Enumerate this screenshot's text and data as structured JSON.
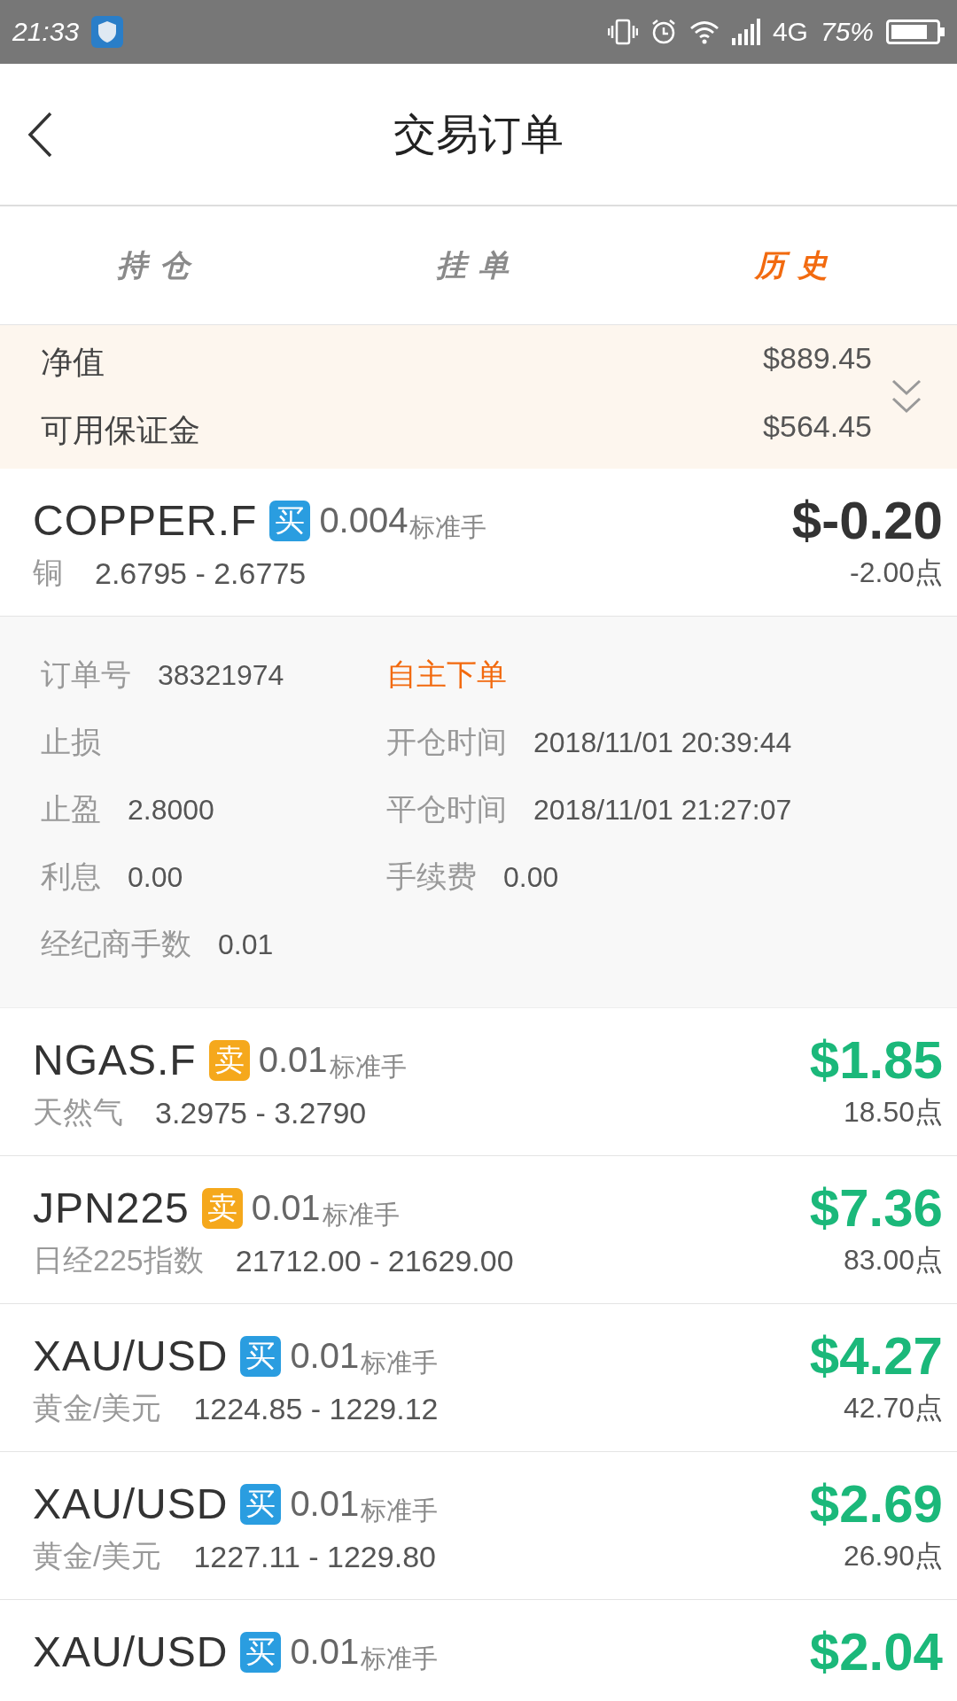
{
  "status_bar": {
    "time": "21:33",
    "network": "4G",
    "battery": "75%"
  },
  "header": {
    "title": "交易订单"
  },
  "tabs": [
    {
      "label": "持仓",
      "selected": false
    },
    {
      "label": "挂单",
      "selected": false
    },
    {
      "label": "历史",
      "selected": true
    }
  ],
  "summary": {
    "rows": [
      {
        "label": "净值",
        "value": "$889.45"
      },
      {
        "label": "可用保证金",
        "value": "$564.45"
      }
    ]
  },
  "orders": [
    {
      "symbol": "COPPER.F",
      "kind": "buy",
      "side_label": "买",
      "lots": "0.004",
      "lot_unit": "标准手",
      "profit": "$-0.20",
      "color": "#333333",
      "name": "铜",
      "prices": "2.6795 - 2.6775",
      "points": "-2.00点",
      "details": [
        {
          "kind": "field",
          "label": "订单号",
          "value": "38321974"
        },
        {
          "kind": "tag",
          "text": "自主下单"
        },
        {
          "kind": "field",
          "label": "止损"
        },
        {
          "kind": "field",
          "label": "开仓时间",
          "value": "2018/11/01 20:39:44"
        },
        {
          "kind": "field",
          "label": "止盈",
          "value": "2.8000"
        },
        {
          "kind": "field",
          "label": "平仓时间",
          "value": "2018/11/01 21:27:07"
        },
        {
          "kind": "field",
          "label": "利息",
          "value": "0.00"
        },
        {
          "kind": "field",
          "label": "手续费",
          "value": "0.00"
        },
        {
          "kind": "field",
          "label": "经纪商手数",
          "value": "0.01"
        }
      ]
    },
    {
      "symbol": "NGAS.F",
      "kind": "sell",
      "side_label": "卖",
      "lots": "0.01",
      "lot_unit": "标准手",
      "profit": "$1.85",
      "color": "#1bb87a",
      "name": "天然气",
      "prices": "3.2975 - 3.2790",
      "points": "18.50点"
    },
    {
      "symbol": "JPN225",
      "kind": "sell",
      "side_label": "卖",
      "lots": "0.01",
      "lot_unit": "标准手",
      "profit": "$7.36",
      "color": "#1bb87a",
      "name": "日经225指数",
      "prices": "21712.00 - 21629.00",
      "points": "83.00点"
    },
    {
      "symbol": "XAU/USD",
      "kind": "buy",
      "side_label": "买",
      "lots": "0.01",
      "lot_unit": "标准手",
      "profit": "$4.27",
      "color": "#1bb87a",
      "name": "黄金/美元",
      "prices": "1224.85 - 1229.12",
      "points": "42.70点"
    },
    {
      "symbol": "XAU/USD",
      "kind": "buy",
      "side_label": "买",
      "lots": "0.01",
      "lot_unit": "标准手",
      "profit": "$2.69",
      "color": "#1bb87a",
      "name": "黄金/美元",
      "prices": "1227.11 - 1229.80",
      "points": "26.90点"
    },
    {
      "symbol": "XAU/USD",
      "kind": "buy",
      "side_label": "买",
      "lots": "0.01",
      "lot_unit": "标准手",
      "profit": "$2.04",
      "color": "#1bb87a"
    }
  ]
}
